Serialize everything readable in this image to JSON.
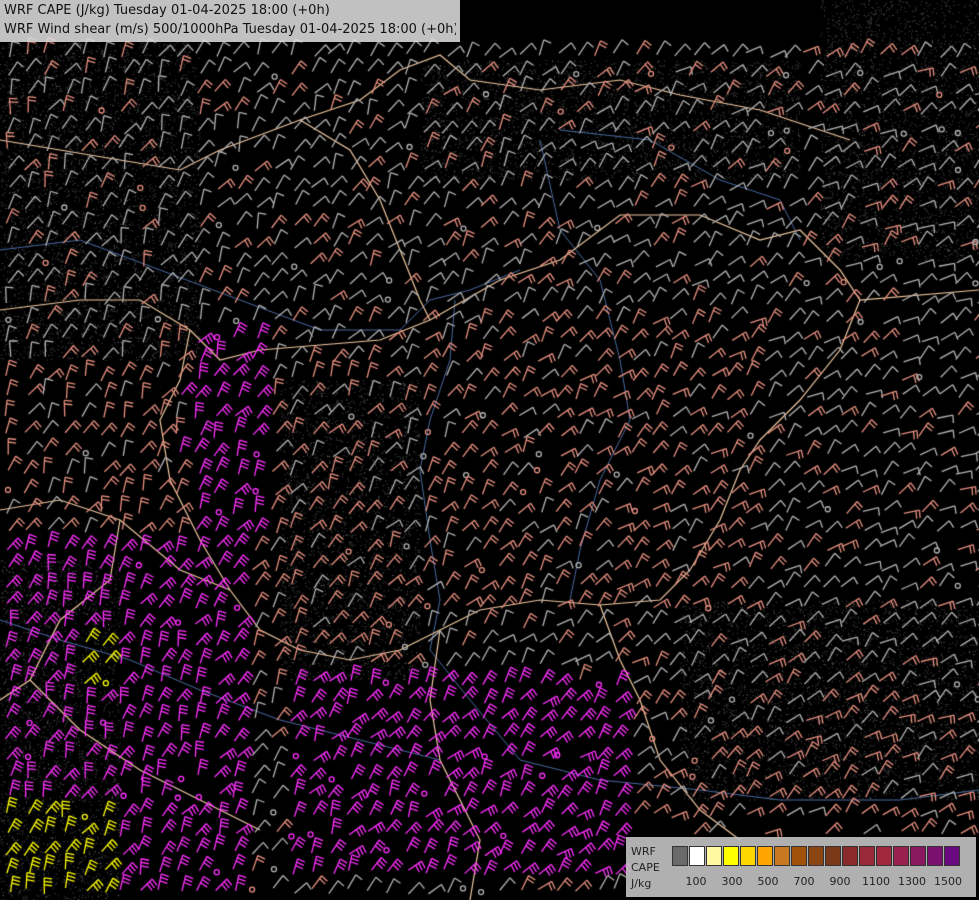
{
  "header": {
    "line1": "WRF CAPE (J/kg) Tuesday 01-04-2025 18:00 (+0h)",
    "line2": "WRF Wind shear (m/s) 500/1000hPa Tuesday 01-04-2025 18:00 (+0h)"
  },
  "legend": {
    "model": "WRF",
    "variable": "CAPE",
    "unit": "J/kg",
    "ticks": [
      "100",
      "300",
      "500",
      "700",
      "900",
      "1100",
      "1300",
      "1500"
    ],
    "colors": [
      "#6a6a6a",
      "#ffffff",
      "#fff8a0",
      "#ffff00",
      "#ffd700",
      "#ffa500",
      "#c87820",
      "#a0520a",
      "#8b4513",
      "#7a3a1a",
      "#8b2a2a",
      "#9a2a3a",
      "#a0283f",
      "#9a2050",
      "#8a1860",
      "#7a1070",
      "#6a0880"
    ]
  },
  "map_colors": {
    "background": "#000000",
    "border": "#f0c8a0",
    "river": "#4a6aa0",
    "barb_low": "#b4b4b4",
    "barb_mid": "#e89080",
    "barb_high": "#ff30ff",
    "barb_extreme": "#ffff00"
  }
}
